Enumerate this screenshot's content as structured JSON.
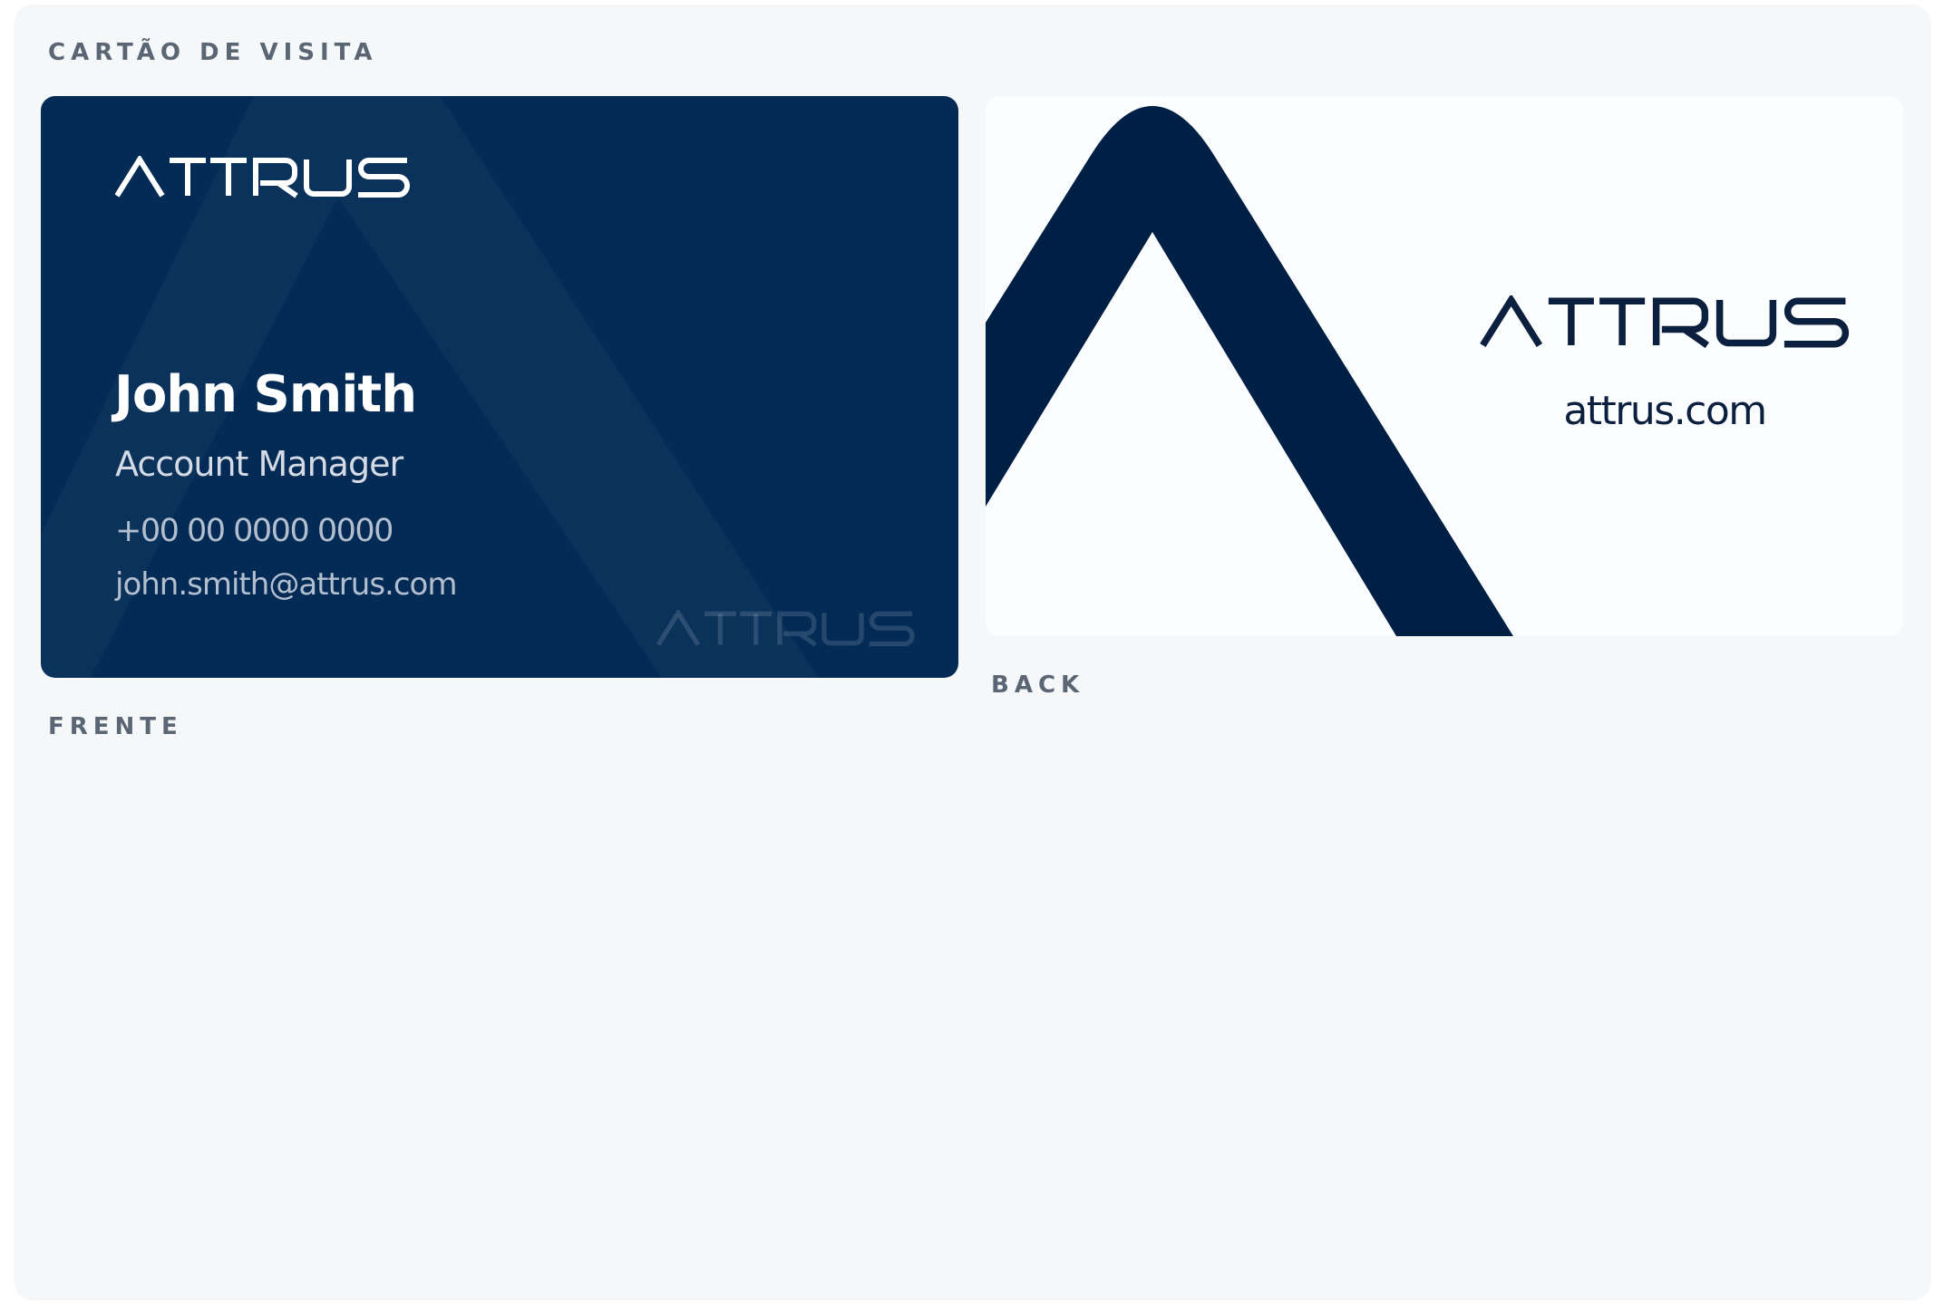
{
  "header": {
    "title": "CARTÃO DE VISITA"
  },
  "front": {
    "label": "FRENTE",
    "logo_text": "ATTRUS",
    "watermark_text": "ATTRUS",
    "name": "John Smith",
    "role": "Account Manager",
    "phone": "+00 00 0000 0000",
    "email": "john.smith@attrus.com"
  },
  "back": {
    "label": "BACK",
    "logo_text": "ATTRUS",
    "website": "attrus.com"
  },
  "colors": {
    "navy": "#032b55",
    "dark_navy": "#001f45",
    "panel_background": "#f5f7f9",
    "label_gray": "#5b6675"
  },
  "icons": {
    "front_logo": "attrus-wordmark-icon",
    "back_mark": "attrus-a-mark-icon"
  }
}
